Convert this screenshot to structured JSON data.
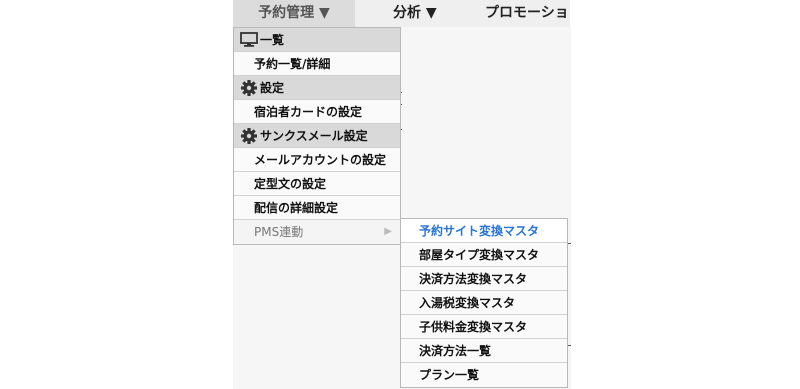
{
  "topnav": {
    "tabs": [
      {
        "label": "予約管理 ▼"
      },
      {
        "label": "分析 ▼"
      },
      {
        "label": "プロモーショ"
      }
    ]
  },
  "dropdown": {
    "items": [
      {
        "label": "一覧",
        "type": "header",
        "icon": "monitor-icon"
      },
      {
        "label": "予約一覧/詳細",
        "type": "item"
      },
      {
        "label": "設定",
        "type": "header",
        "icon": "gear-icon"
      },
      {
        "label": "宿泊者カードの設定",
        "type": "item"
      },
      {
        "label": "サンクスメール設定",
        "type": "header",
        "icon": "gear-icon"
      },
      {
        "label": "メールアカウントの設定",
        "type": "item"
      },
      {
        "label": "定型文の設定",
        "type": "item"
      },
      {
        "label": "配信の詳細設定",
        "type": "item"
      },
      {
        "label": "PMS連動",
        "type": "submenu"
      }
    ]
  },
  "submenu": {
    "items": [
      {
        "label": "予約サイト変換マスタ",
        "active": true
      },
      {
        "label": "部屋タイプ変換マスタ"
      },
      {
        "label": "決済方法変換マスタ"
      },
      {
        "label": "入湯税変換マスタ"
      },
      {
        "label": "子供料金変換マスタ"
      },
      {
        "label": "決済方法一覧"
      },
      {
        "label": "プラン一覧"
      }
    ]
  },
  "colors": {
    "active_link": "#2a74d8",
    "header_bg": "#d9d9d9",
    "active_tab_bg": "#dcdcdc"
  }
}
